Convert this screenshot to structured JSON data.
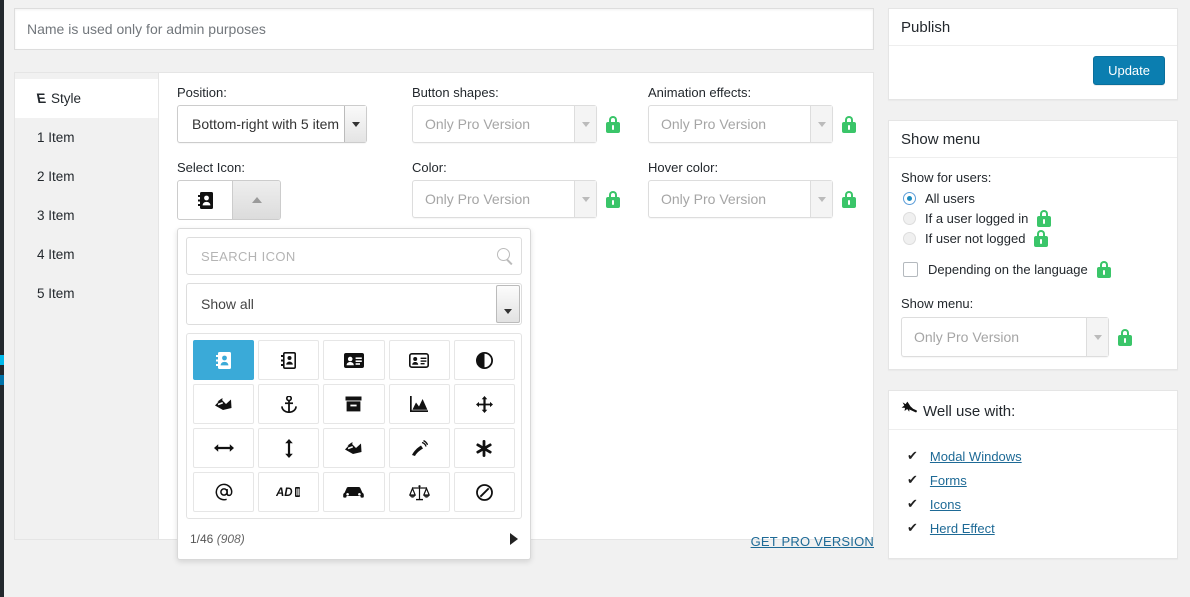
{
  "title_field": {
    "value": "",
    "placeholder": "Name is used only for admin purposes"
  },
  "tabs": [
    {
      "label": "Style",
      "icon": "style-icon",
      "active": true
    },
    {
      "label": "1 Item",
      "active": false
    },
    {
      "label": "2 Item",
      "active": false
    },
    {
      "label": "3 Item",
      "active": false
    },
    {
      "label": "4 Item",
      "active": false
    },
    {
      "label": "5 Item",
      "active": false
    }
  ],
  "fields": {
    "position": {
      "label": "Position:",
      "value": "Bottom-right with 5 item"
    },
    "button_shapes": {
      "label": "Button shapes:",
      "value": "Only Pro Version",
      "locked": true
    },
    "animation_effects": {
      "label": "Animation effects:",
      "value": "Only Pro Version",
      "locked": true
    },
    "select_icon": {
      "label": "Select Icon:",
      "current_icon": "address-book-icon"
    },
    "color": {
      "label": "Color:",
      "value": "Only Pro Version",
      "locked": true
    },
    "hover_color": {
      "label": "Hover color:",
      "value": "Only Pro Version",
      "locked": true
    }
  },
  "icon_picker": {
    "search_placeholder": "SEARCH ICON",
    "search_value": "",
    "filter_value": "Show all",
    "page_label": "1/46",
    "total_label": "(908)",
    "next_icon": "next-page-arrow-icon",
    "selected_index": 0,
    "icons": [
      {
        "name": "address-book-icon",
        "glyph": "📕"
      },
      {
        "name": "address-book-o-icon",
        "glyph": "📓"
      },
      {
        "name": "address-card-icon",
        "glyph": "🪪"
      },
      {
        "name": "address-card-o-icon",
        "glyph": "🪪"
      },
      {
        "name": "adjust-icon",
        "glyph": "◐"
      },
      {
        "name": "adn-icon",
        "glyph": "🏴"
      },
      {
        "name": "anchor-icon",
        "glyph": "⚓"
      },
      {
        "name": "archive-icon",
        "glyph": "🗃"
      },
      {
        "name": "area-chart-icon",
        "glyph": "📈"
      },
      {
        "name": "arrows-icon",
        "glyph": "✛"
      },
      {
        "name": "arrows-h-icon",
        "glyph": "↔"
      },
      {
        "name": "arrows-v-icon",
        "glyph": "↕"
      },
      {
        "name": "assistive-listening-systems-icon",
        "glyph": "🏴"
      },
      {
        "name": "audio-description-icon",
        "glyph": "📡"
      },
      {
        "name": "asterisk-icon",
        "glyph": "✱"
      },
      {
        "name": "at-icon",
        "glyph": "@"
      },
      {
        "name": "ad-icon",
        "glyph": "AD"
      },
      {
        "name": "automobile-icon",
        "glyph": "🚗"
      },
      {
        "name": "balance-scale-icon",
        "glyph": "⚖"
      },
      {
        "name": "ban-icon",
        "glyph": "⊘"
      }
    ]
  },
  "get_pro": {
    "label": "GET PRO VERSION"
  },
  "publish_box": {
    "title": "Publish",
    "update_label": "Update"
  },
  "show_menu_box": {
    "title": "Show menu",
    "show_for_users_label": "Show for users:",
    "options": [
      {
        "label": "All users",
        "selected": true,
        "locked": false
      },
      {
        "label": "If a user logged in",
        "selected": false,
        "locked": true
      },
      {
        "label": "If user not logged",
        "selected": false,
        "locked": true
      }
    ],
    "language_checkbox": {
      "label": "Depending on the language",
      "checked": false,
      "locked": true
    },
    "show_menu_label": "Show menu:",
    "show_menu_select": {
      "value": "Only Pro Version",
      "locked": true
    }
  },
  "use_with_box": {
    "title": "Well use with:",
    "icon": "plug-icon",
    "links": [
      {
        "label": "Modal Windows"
      },
      {
        "label": "Forms"
      },
      {
        "label": "Icons"
      },
      {
        "label": "Herd Effect"
      }
    ]
  },
  "colors": {
    "accent_blue": "#3aaad8",
    "button_blue": "#0b7eb0",
    "lock_green": "#3ac569",
    "link_blue": "#1e6a96",
    "page_bg": "#f1f1f1"
  }
}
